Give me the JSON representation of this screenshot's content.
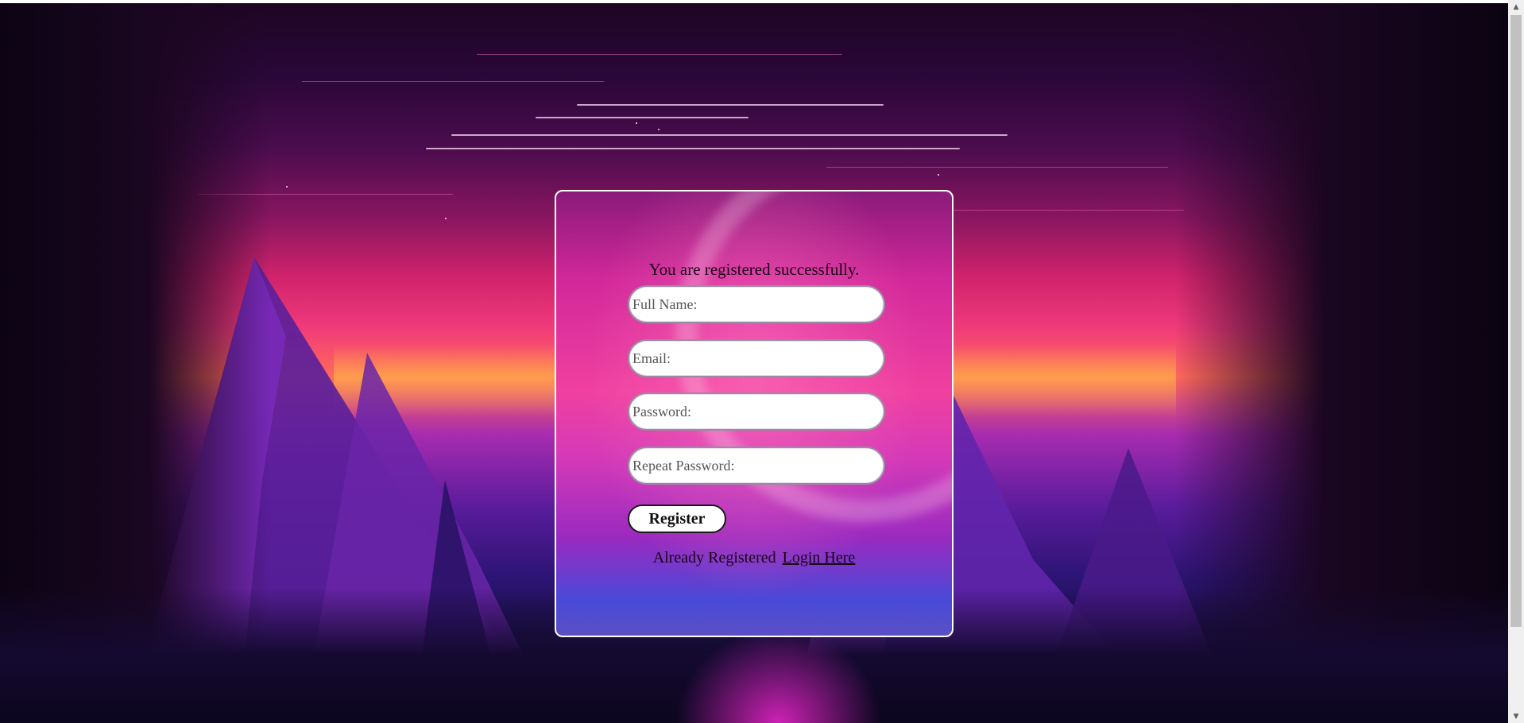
{
  "message": {
    "text": "You are registered successfully."
  },
  "form": {
    "full_name_placeholder": "Full Name:",
    "email_placeholder": "Email:",
    "password_placeholder": "Password:",
    "repeat_password_placeholder": "Repeat Password:",
    "register_label": "Register"
  },
  "footer": {
    "prompt": "Already Registered",
    "login_link": "Login Here"
  },
  "colors": {
    "panel_border": "#ffffff",
    "button_bg": "#ffffff",
    "text": "#1a0016"
  },
  "icons": {
    "scroll_up": "scroll-up-arrow-icon",
    "scroll_down": "scroll-down-arrow-icon"
  }
}
